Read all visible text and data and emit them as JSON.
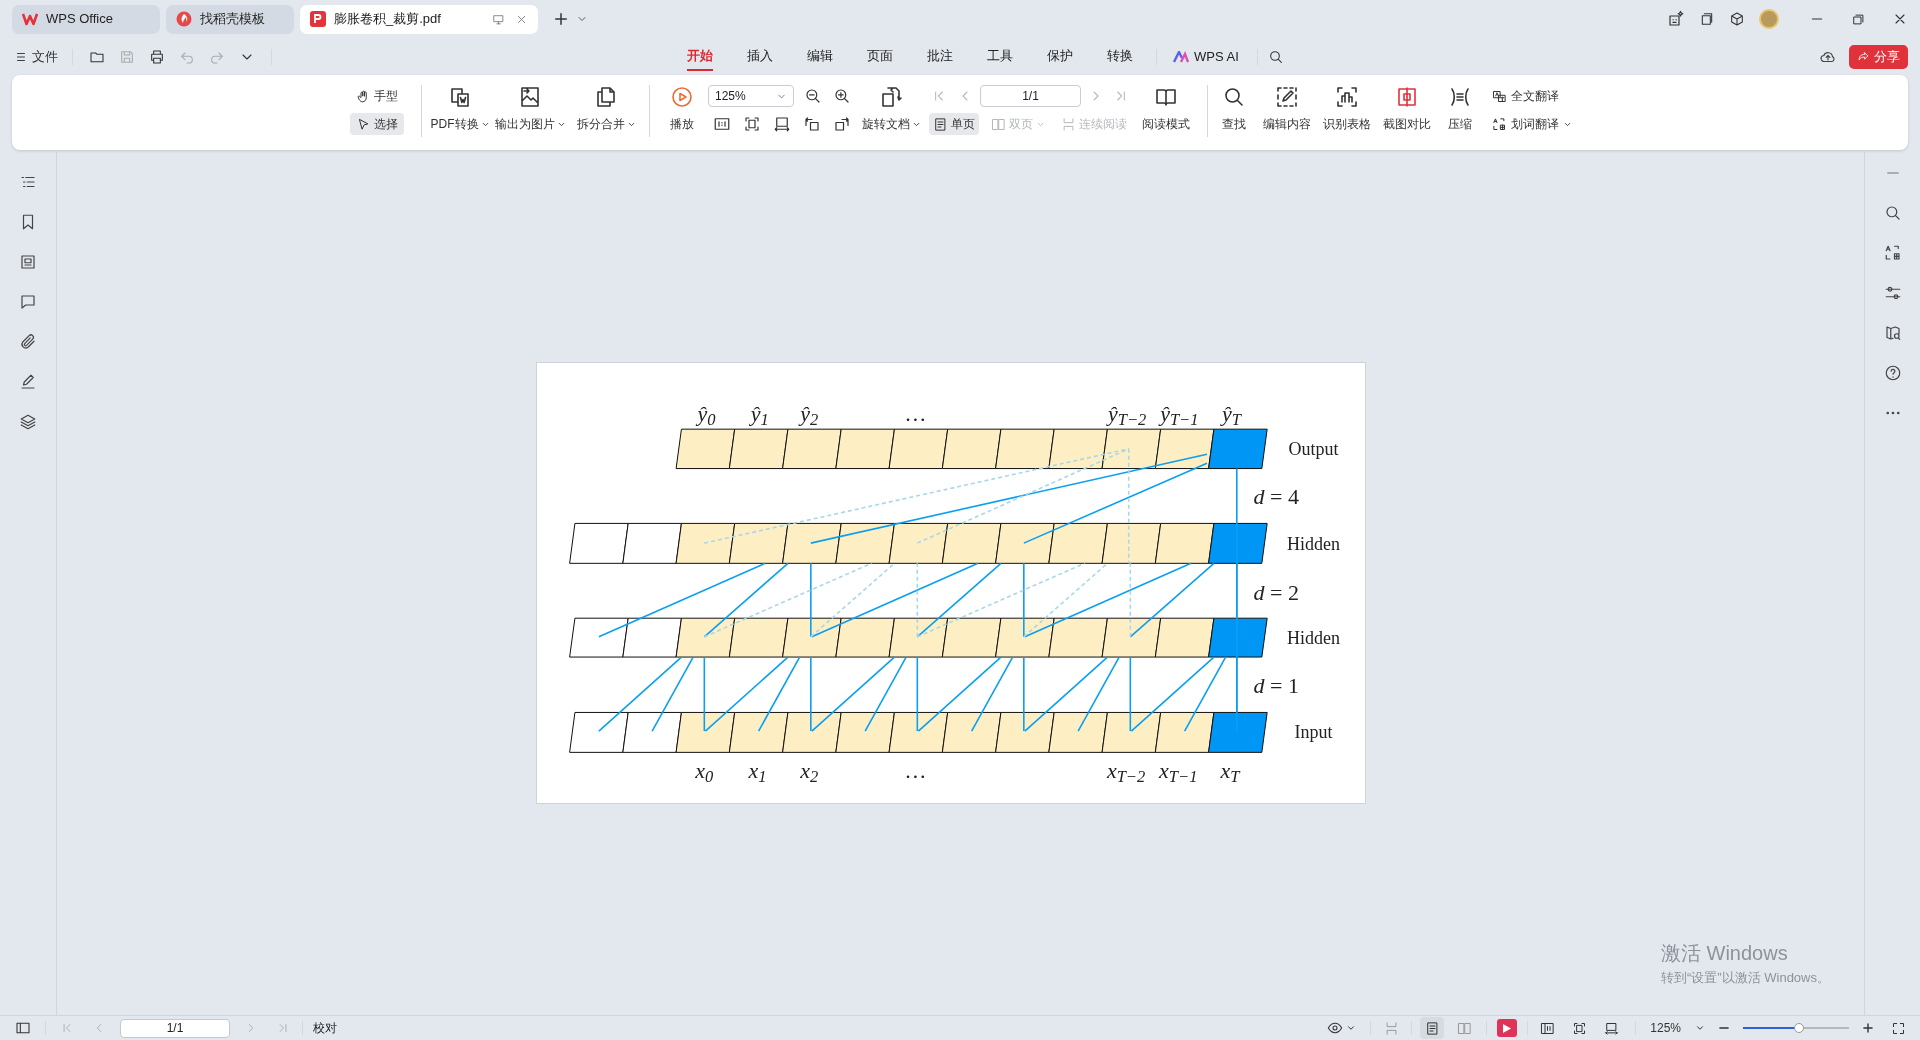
{
  "window_tabs": [
    {
      "label": "WPS Office",
      "kind": "home",
      "selected": false
    },
    {
      "label": "找稻壳模板",
      "kind": "template",
      "selected": false
    },
    {
      "label": "膨胀卷积_裁剪.pdf",
      "kind": "pdf",
      "selected": true
    }
  ],
  "menu": {
    "file": "文件",
    "tabs": [
      {
        "label": "开始",
        "selected": true
      },
      {
        "label": "插入",
        "selected": false
      },
      {
        "label": "编辑",
        "selected": false
      },
      {
        "label": "页面",
        "selected": false
      },
      {
        "label": "批注",
        "selected": false
      },
      {
        "label": "工具",
        "selected": false
      },
      {
        "label": "保护",
        "selected": false
      },
      {
        "label": "转换",
        "selected": false
      }
    ],
    "ai": "WPS AI",
    "share": "分享"
  },
  "ribbon": {
    "pointer_tools": [
      {
        "label": "手型",
        "selected": false
      },
      {
        "label": "选择",
        "selected": true
      }
    ],
    "convert_group": [
      {
        "label": "PDF转换",
        "dropdown": true
      },
      {
        "label": "输出为图片",
        "dropdown": true
      },
      {
        "label": "拆分合并",
        "dropdown": true
      }
    ],
    "play": "播放",
    "zoom": "125%",
    "rotate": {
      "label": "旋转文档",
      "dropdown": true
    },
    "page_field": "1/1",
    "view_modes": [
      {
        "label": "单页",
        "selected": true,
        "disabled": false,
        "dropdown": false
      },
      {
        "label": "双页",
        "selected": false,
        "disabled": true,
        "dropdown": true
      },
      {
        "label": "连续阅读",
        "selected": false,
        "disabled": true,
        "dropdown": false
      }
    ],
    "read_mode": "阅读模式",
    "tools": [
      "查找",
      "编辑内容",
      "识别表格",
      "截图对比",
      "压缩"
    ],
    "translate": [
      {
        "label": "全文翻译",
        "dropdown": false
      },
      {
        "label": "划词翻译",
        "dropdown": true
      }
    ]
  },
  "document": {
    "diagram": {
      "output_labels": [
        "ŷ$_{0}$",
        "ŷ$_{1}$",
        "ŷ$_{2}$",
        "…",
        "ŷ$_{T−2}$",
        "ŷ$_{T−1}$",
        "ŷ$_{T}$"
      ],
      "input_labels": [
        "x$_{0}$",
        "x$_{1}$",
        "x$_{2}$",
        "…",
        "x$_{T−2}$",
        "x$_{T−1}$",
        "x$_{T}$"
      ],
      "layer_labels": [
        "Output",
        "Hidden",
        "Hidden",
        "Input"
      ],
      "dilations": [
        "*d* = 4",
        "*d* = 2",
        "*d* = 1"
      ]
    }
  },
  "os_watermark": [
    "激活 Windows",
    "转到“设置”以激活 Windows。"
  ],
  "status_bar": {
    "page_field": "1/1",
    "proofread": "校对",
    "view_buttons": [
      {
        "selected": false
      },
      {
        "selected": true
      },
      {
        "selected": false
      }
    ],
    "zoom": "125%",
    "zoom_slider": {
      "level": 0.53
    }
  }
}
